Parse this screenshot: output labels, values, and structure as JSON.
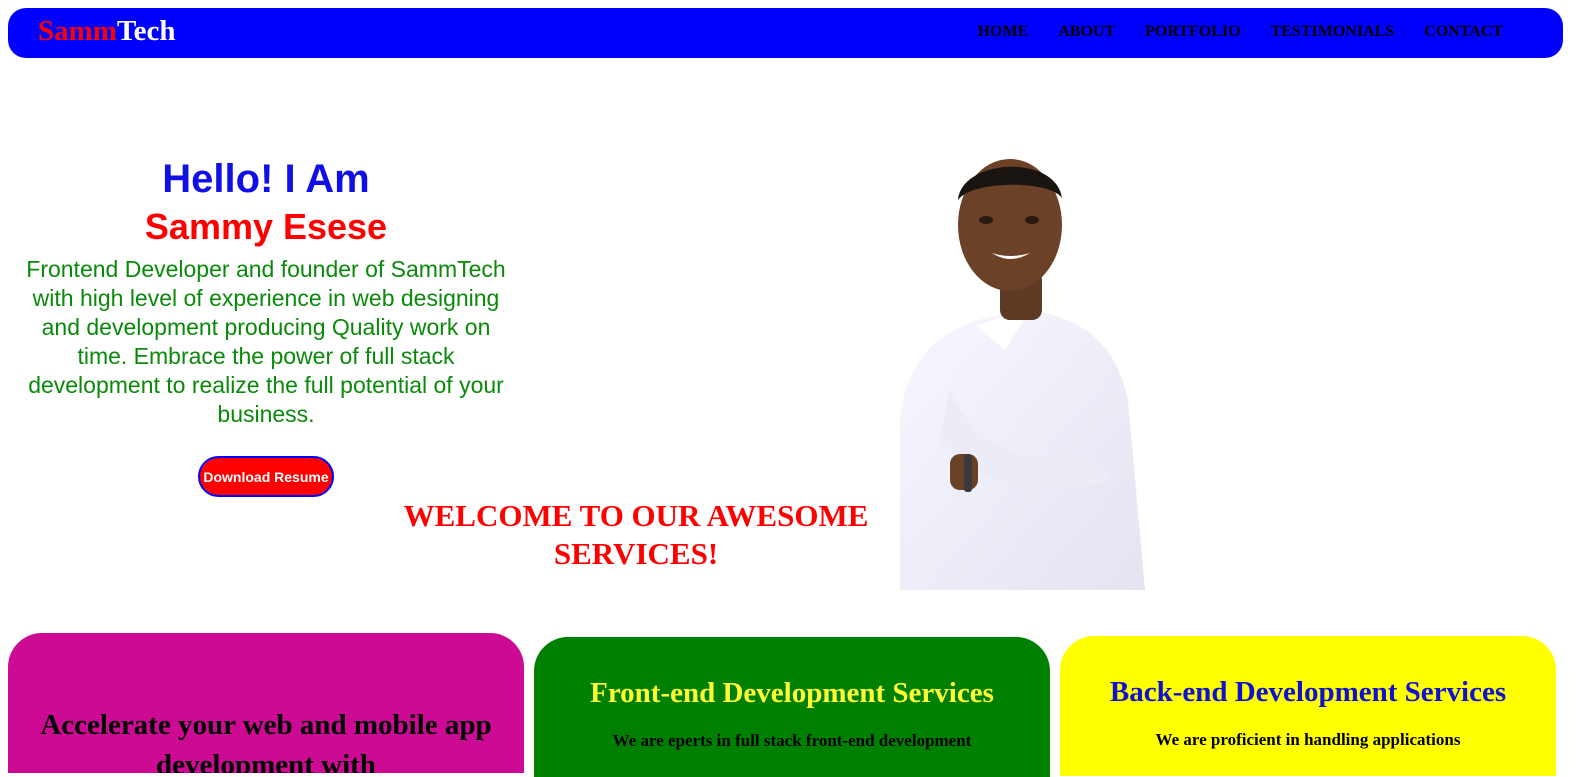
{
  "header": {
    "logo_part1": "Samm",
    "logo_part2": "Tech",
    "nav": [
      "HOME",
      "ABOUT",
      "PORTFOLIO",
      "TESTIMONIALS",
      "CONTACT"
    ]
  },
  "hero": {
    "greeting": "Hello! I Am",
    "name": "Sammy Esese",
    "bio": "Frontend Developer and founder of SammTech with high level of experience in web designing and development producing Quality work on time. Embrace the power of full stack development to realize the full potential of your business.",
    "button_label": "Download Resume"
  },
  "services": {
    "heading": "WELCOME TO OUR AWESOME SERVICES!",
    "cards": [
      {
        "title": "Accelerate your web and mobile app development with",
        "text": ""
      },
      {
        "title": "Front-end Development Services",
        "text": "We are eperts in full stack front-end development"
      },
      {
        "title": "Back-end Development Services",
        "text": "We are proficient in handling applications"
      }
    ]
  },
  "colors": {
    "navbar": "#0000ff",
    "accent_red": "#ff0000",
    "bio_green": "#0a8a0a",
    "card1": "#cc0a94",
    "card2": "#008000",
    "card3": "#ffff00"
  }
}
